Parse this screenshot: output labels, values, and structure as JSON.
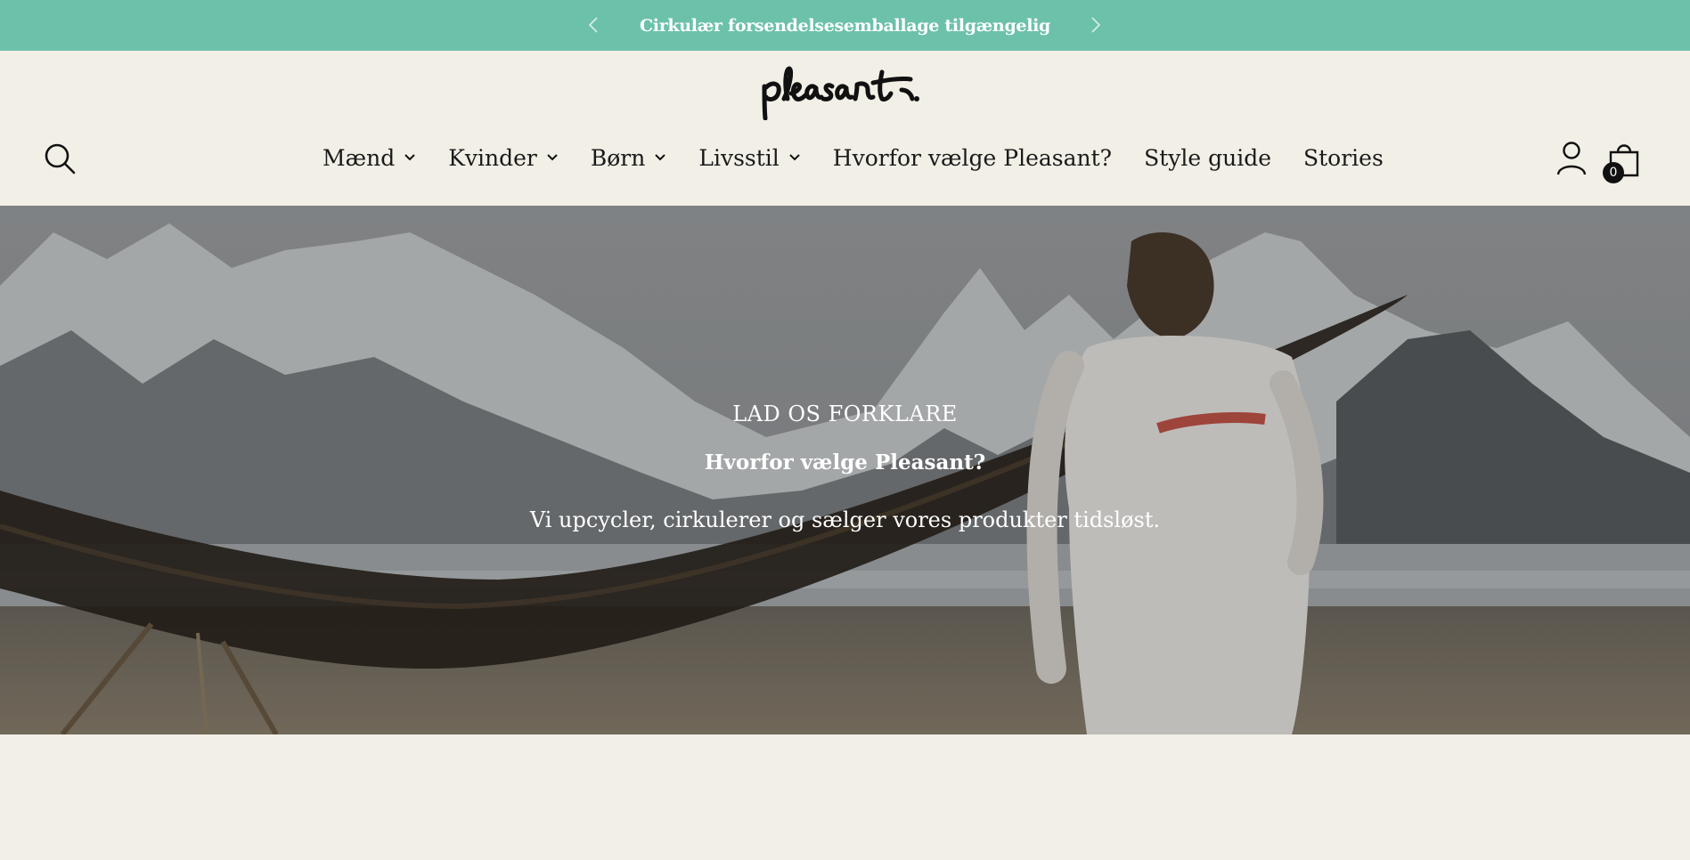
{
  "announcement": {
    "message": "Cirkulær forsendelsesemballage tilgængelig",
    "prev_icon": "chevron-left-icon",
    "next_icon": "chevron-right-icon"
  },
  "header": {
    "logo_text": "pleasant.",
    "search_icon": "search-icon",
    "account_icon": "user-icon",
    "cart_icon": "shopping-bag-icon",
    "cart_count": "0"
  },
  "nav": {
    "items": [
      {
        "label": "Mænd",
        "has_dropdown": true
      },
      {
        "label": "Kvinder",
        "has_dropdown": true
      },
      {
        "label": "Børn",
        "has_dropdown": true
      },
      {
        "label": "Livsstil",
        "has_dropdown": true
      },
      {
        "label": "Hvorfor vælge Pleasant?",
        "has_dropdown": false
      },
      {
        "label": "Style guide",
        "has_dropdown": false
      },
      {
        "label": "Stories",
        "has_dropdown": false
      }
    ]
  },
  "hero": {
    "eyebrow": "LAD OS FORKLARE",
    "title": "Hvorfor vælge Pleasant?",
    "subtitle": "Vi upcycler, cirkulerer og sælger vores produkter tidsløst."
  },
  "colors": {
    "announcement_bg": "#6cc1ab",
    "page_bg": "#f2efe6",
    "text": "#1a1a1a"
  }
}
